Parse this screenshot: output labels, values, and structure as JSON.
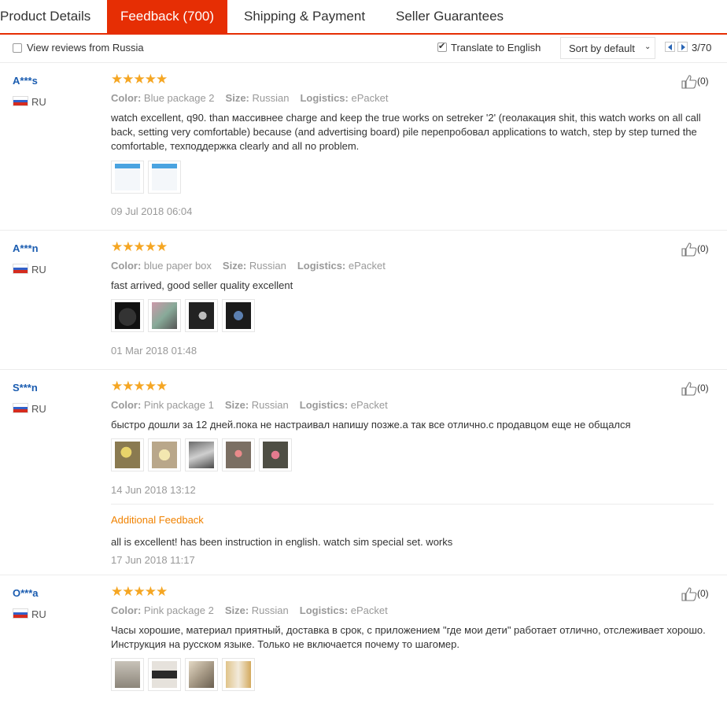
{
  "tabs": [
    {
      "label": "Product Details",
      "active": false
    },
    {
      "label": "Feedback (700)",
      "active": true
    },
    {
      "label": "Shipping & Payment",
      "active": false
    },
    {
      "label": "Seller Guarantees",
      "active": false
    }
  ],
  "toolbar": {
    "view_reviews_label": "View reviews from Russia",
    "view_reviews_checked": false,
    "translate_label": "Translate to English",
    "translate_checked": true,
    "sort_label": "Sort by default",
    "page_indicator": "3/70"
  },
  "colors": {
    "accent": "#e62e04",
    "star": "#f5a623",
    "username": "#1a5cb0",
    "additional": "#f08200"
  },
  "labels": {
    "color": "Color:",
    "size": "Size:",
    "logistics": "Logistics:",
    "additional_feedback": "Additional Feedback"
  },
  "reviews": [
    {
      "user": "A***s",
      "country": "RU",
      "stars": "★★★★★",
      "color": "Blue package 2",
      "size": "Russian",
      "logistics": "ePacket",
      "text": "watch excellent, q90. than массивнее charge and keep the true works on setreker '2' (геолакация shit, this watch works on all call back, setting very comfortable) because (and advertising board) pile перепробовал applications to watch, step by step turned the comfortable, техподдержка clearly and all no problem.",
      "date": "09 Jul 2018 06:04",
      "likes": "(0)"
    },
    {
      "user": "A***n",
      "country": "RU",
      "stars": "★★★★★",
      "color": "blue paper box",
      "size": "Russian",
      "logistics": "ePacket",
      "text": "fast arrived, good seller quality excellent",
      "date": "01 Mar 2018 01:48",
      "likes": "(0)"
    },
    {
      "user": "S***n",
      "country": "RU",
      "stars": "★★★★★",
      "color": "Pink package 1",
      "size": "Russian",
      "logistics": "ePacket",
      "text": "быстро дошли за 12 дней.пока не настраивал напишу позже.а так все отлично.с продавцом еще не общался",
      "date": "14 Jun 2018 13:12",
      "likes": "(0)",
      "additional_text": "all is excellent! has been instruction in english. watch sim special set. works",
      "additional_date": "17 Jun 2018 11:17"
    },
    {
      "user": "O***a",
      "country": "RU",
      "stars": "★★★★★",
      "color": "Pink package 2",
      "size": "Russian",
      "logistics": "ePacket",
      "text": "Часы хорошие, материал приятный, доставка в срок, с приложением \"где мои дети\" работает отлично, отслеживает хорошо. Инструкция на русском языке. Только не включается почему то шагомер.",
      "likes": "(0)"
    }
  ]
}
